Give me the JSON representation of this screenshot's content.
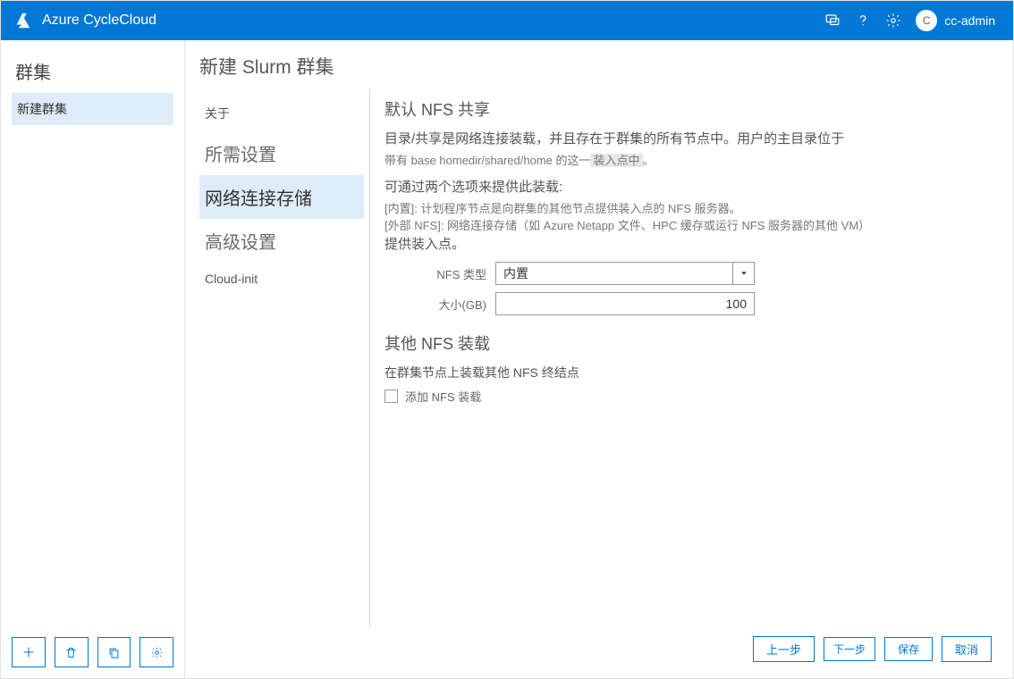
{
  "topbar": {
    "product": "Azure CycleCloud",
    "user_initial": "C",
    "username": "cc-admin"
  },
  "sidebar": {
    "heading": "群集",
    "items": [
      {
        "label": "新建群集",
        "active": true
      }
    ],
    "toolbar_icons": [
      "plus-icon",
      "trash-icon",
      "copy-icon",
      "gear-icon"
    ]
  },
  "page": {
    "title": "新建 Slurm 群集"
  },
  "steps": [
    {
      "label": "关于",
      "small": true
    },
    {
      "label": "所需设置"
    },
    {
      "label": "网络连接存储",
      "active": true
    },
    {
      "label": "高级设置"
    },
    {
      "label": "Cloud-init",
      "small": true
    }
  ],
  "panel": {
    "section1_title": "默认 NFS 共享",
    "desc1_line1": "目录/共享是网络连接装载，并且存在于群集的所有节点中。用户的主目录位于",
    "desc1_line2_prefix": "带有 base homedir/shared/home 的这一",
    "desc1_line2_hl": "装入点中",
    "desc1_line2_suffix": "。",
    "desc2": "可通过两个选项来提供此装载:",
    "desc2_opt1": "[内置]: 计划程序节点是向群集的其他节点提供装入点的 NFS 服务器。",
    "desc2_opt2": "[外部 NFS]: 网络连接存储（如 Azure Netapp 文件、HPC 缓存或运行 NFS 服务器的其他 VM）",
    "desc2_tail": "提供装入点。",
    "form": {
      "nfs_type_label": "NFS 类型",
      "nfs_type_value": "内置",
      "size_label": "大小(GB)",
      "size_value": "100"
    },
    "section2_title": "其他 NFS 装载",
    "section2_desc": "在群集节点上装载其他 NFS 终结点",
    "add_nfs_label": "添加 NFS 装载"
  },
  "footer": {
    "prev": "上一步",
    "next": "下一步",
    "save": "保存",
    "cancel": "取消"
  }
}
